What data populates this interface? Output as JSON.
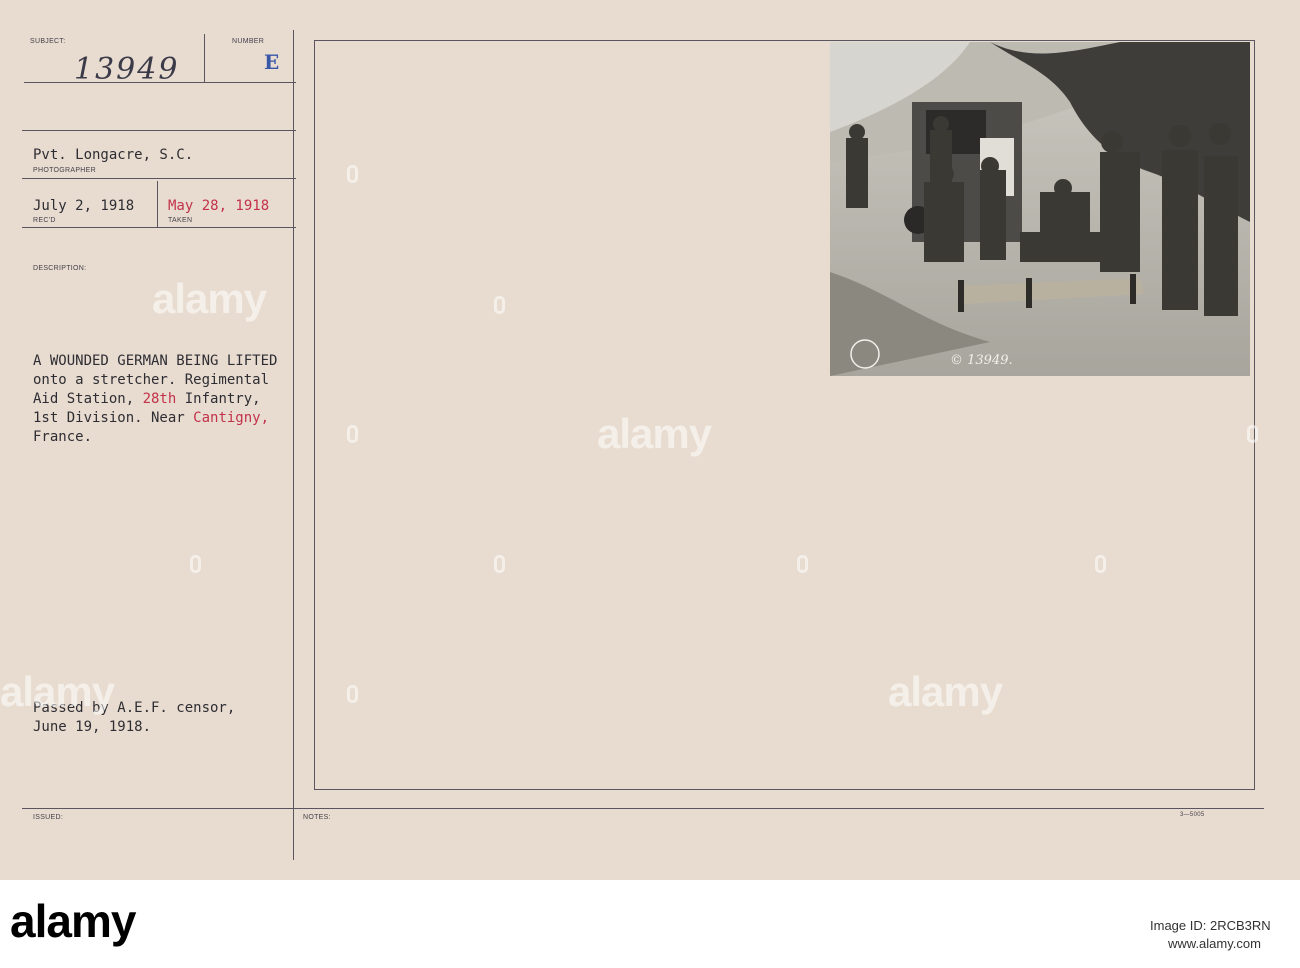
{
  "card": {
    "labels": {
      "subject": "SUBJECT:",
      "number": "NUMBER",
      "photographer": "PHOTOGRAPHER",
      "recd": "REC'D",
      "taken": "TAKEN",
      "description": "DESCRIPTION:",
      "issued": "ISSUED:",
      "notes": "NOTES:"
    },
    "subject_number": "13949",
    "number_letter": "E",
    "photographer": "Pvt. Longacre, S.C.",
    "received_date": "July 2, 1918",
    "taken_date": "May 28, 1918",
    "description": {
      "line1": "A WOUNDED GERMAN BEING LIFTED",
      "line2": "onto a stretcher. Regimental",
      "line3": "Aid Station, ",
      "line3_red": "28th",
      "line3_end": " Infantry,",
      "line4": "1st Division. Near ",
      "line4_red": "Cantigny,",
      "line5": "France."
    },
    "censor": {
      "line1": "Passed by A.E.F. censor,",
      "line2": "June 19, 1918."
    },
    "photo_caption": "© 13949.",
    "form_code": "3—5005"
  },
  "watermark": {
    "text": "alamy"
  },
  "footer": {
    "logo": "alamy",
    "image_id_label": "Image ID: 2RCB3RN",
    "site": "www.alamy.com"
  },
  "colors": {
    "card": "#e8dcd0",
    "typed": "#2e2d33",
    "red_ink": "#c2324a",
    "blue_stamp": "#3857a8"
  }
}
